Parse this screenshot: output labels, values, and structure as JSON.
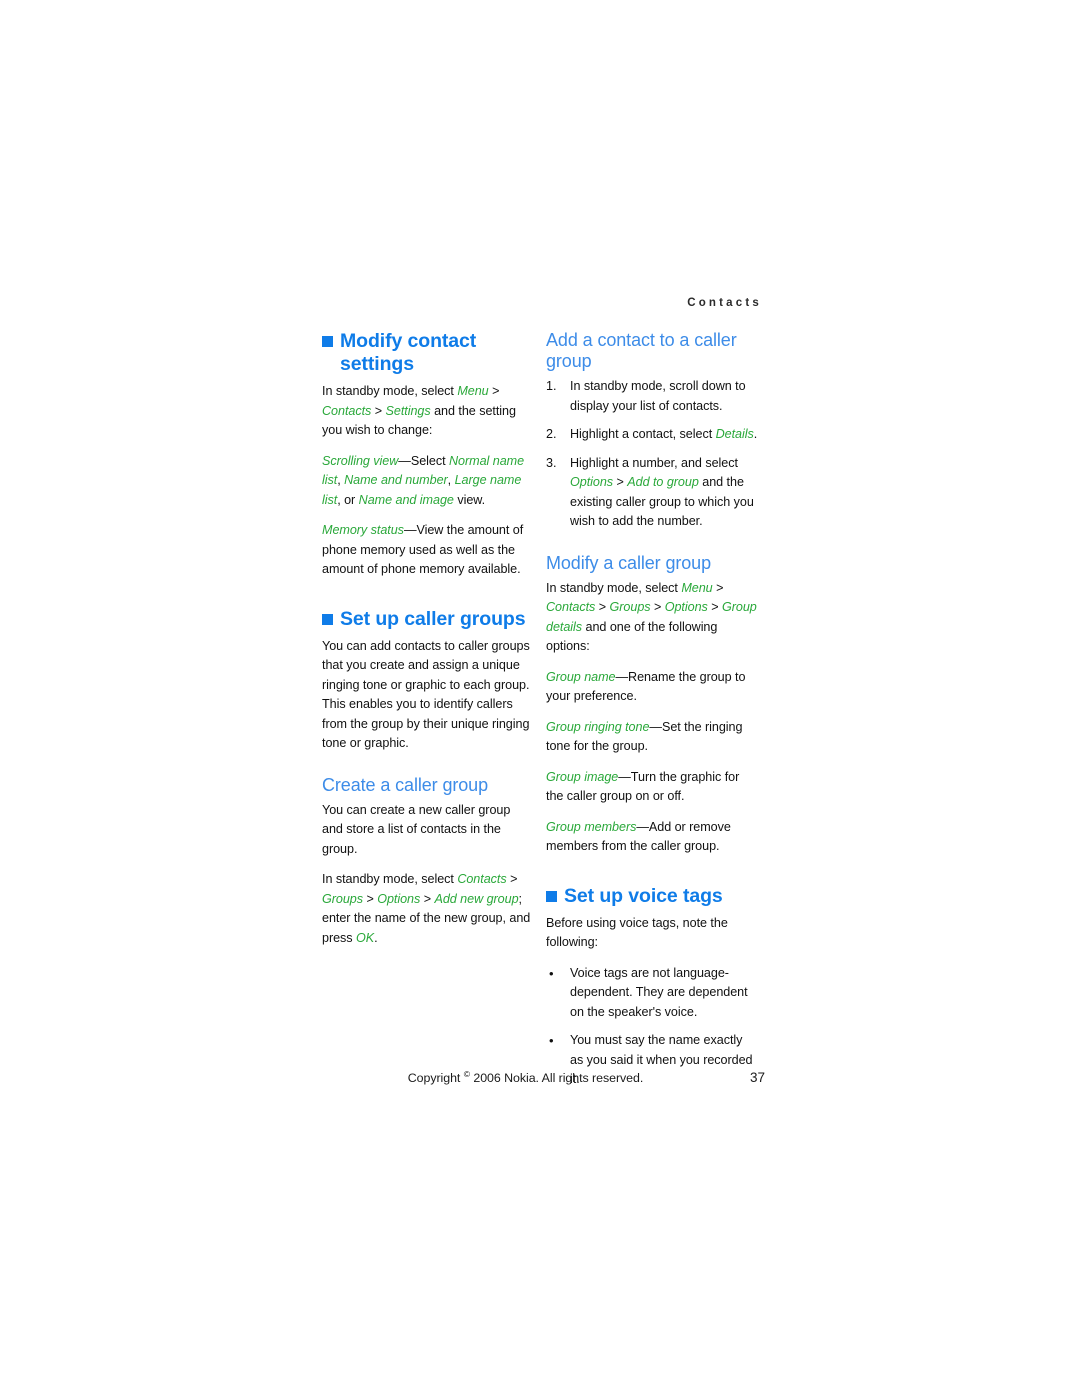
{
  "page": {
    "running_header": "Contacts",
    "page_number": "37",
    "copyright_prefix": "Copyright",
    "copyright_mark": "©",
    "copyright_suffix": "2006 Nokia. All rights reserved."
  },
  "colors": {
    "heading_blue": "#0f7ce8",
    "subheading_blue": "#3d8ce8",
    "emphasis_green": "#2aa83a",
    "body_black": "#111111"
  },
  "left_column": {
    "section1": {
      "heading": "Modify contact settings",
      "bullet_icon": "blue-square-icon",
      "p1_seg1": "In standby mode, select ",
      "p1_menu": "Menu",
      "p1_seg2": " > ",
      "p1_contacts": "Contacts",
      "p1_seg3": " > ",
      "p1_settings": "Settings",
      "p1_seg4": " and the setting you wish to change:",
      "p2_scrolling_view": "Scrolling view",
      "p2_seg1": "—Select ",
      "p2_opt1": "Normal name list",
      "p2_seg2": ", ",
      "p2_opt2": "Name and number",
      "p2_seg3": ", ",
      "p2_opt3": "Large name list",
      "p2_seg4": ", or ",
      "p2_opt4": "Name and image",
      "p2_seg5": " view.",
      "p3_memory_status": "Memory status",
      "p3_seg1": "—View the amount of phone memory used as well as the amount of phone memory available."
    },
    "section2": {
      "heading": "Set up caller groups",
      "bullet_icon": "blue-square-icon",
      "p1": "You can add contacts to caller groups that you create and assign a unique ringing tone or graphic to each group. This enables you to identify callers from the group by their unique ringing tone or graphic.",
      "sub1": {
        "heading": "Create a caller group",
        "p1": "You can create a new caller group and store a list of contacts in the group.",
        "p2_seg1": "In standby mode, select ",
        "p2_contacts": "Contacts",
        "p2_seg2": " > ",
        "p2_groups": "Groups",
        "p2_seg3": " > ",
        "p2_options": "Options",
        "p2_seg4": " > ",
        "p2_addnew": "Add new group",
        "p2_seg5": "; enter the name of the new group, and press ",
        "p2_ok": "OK",
        "p2_seg6": "."
      }
    }
  },
  "right_column": {
    "section1": {
      "heading": "Add a contact to a caller group",
      "steps": [
        {
          "seg1": "In standby mode, scroll down to display your list of contacts."
        },
        {
          "seg1": "Highlight a contact, select ",
          "em1": "Details",
          "seg2": "."
        },
        {
          "seg1": "Highlight a number, and select ",
          "em1": "Options",
          "seg2": " > ",
          "em2": "Add to group",
          "seg3": " and the existing caller group to which you wish to add the number."
        }
      ]
    },
    "section2": {
      "heading": "Modify a caller group",
      "p1_seg1": "In standby mode, select ",
      "p1_menu": "Menu",
      "p1_seg2": " > ",
      "p1_contacts": "Contacts",
      "p1_seg3": " > ",
      "p1_groups": "Groups",
      "p1_seg4": " > ",
      "p1_options": "Options",
      "p1_seg5": " > ",
      "p1_groupdetails": "Group details",
      "p1_seg6": " and one of the following options:",
      "p2_label": "Group name",
      "p2_text": "—Rename the group to your preference.",
      "p3_label": "Group ringing tone",
      "p3_text": "—Set the ringing tone for the group.",
      "p4_label": "Group image",
      "p4_text": "—Turn the graphic for the caller group on or off.",
      "p5_label": "Group members",
      "p5_text": "—Add or remove members from the caller group."
    },
    "section3": {
      "heading": "Set up voice tags",
      "bullet_icon": "blue-square-icon",
      "p1": "Before using voice tags, note the following:",
      "bullets": [
        "Voice tags are not language-dependent. They are dependent on the speaker's voice.",
        "You must say the name exactly as you said it when you recorded it."
      ]
    }
  }
}
